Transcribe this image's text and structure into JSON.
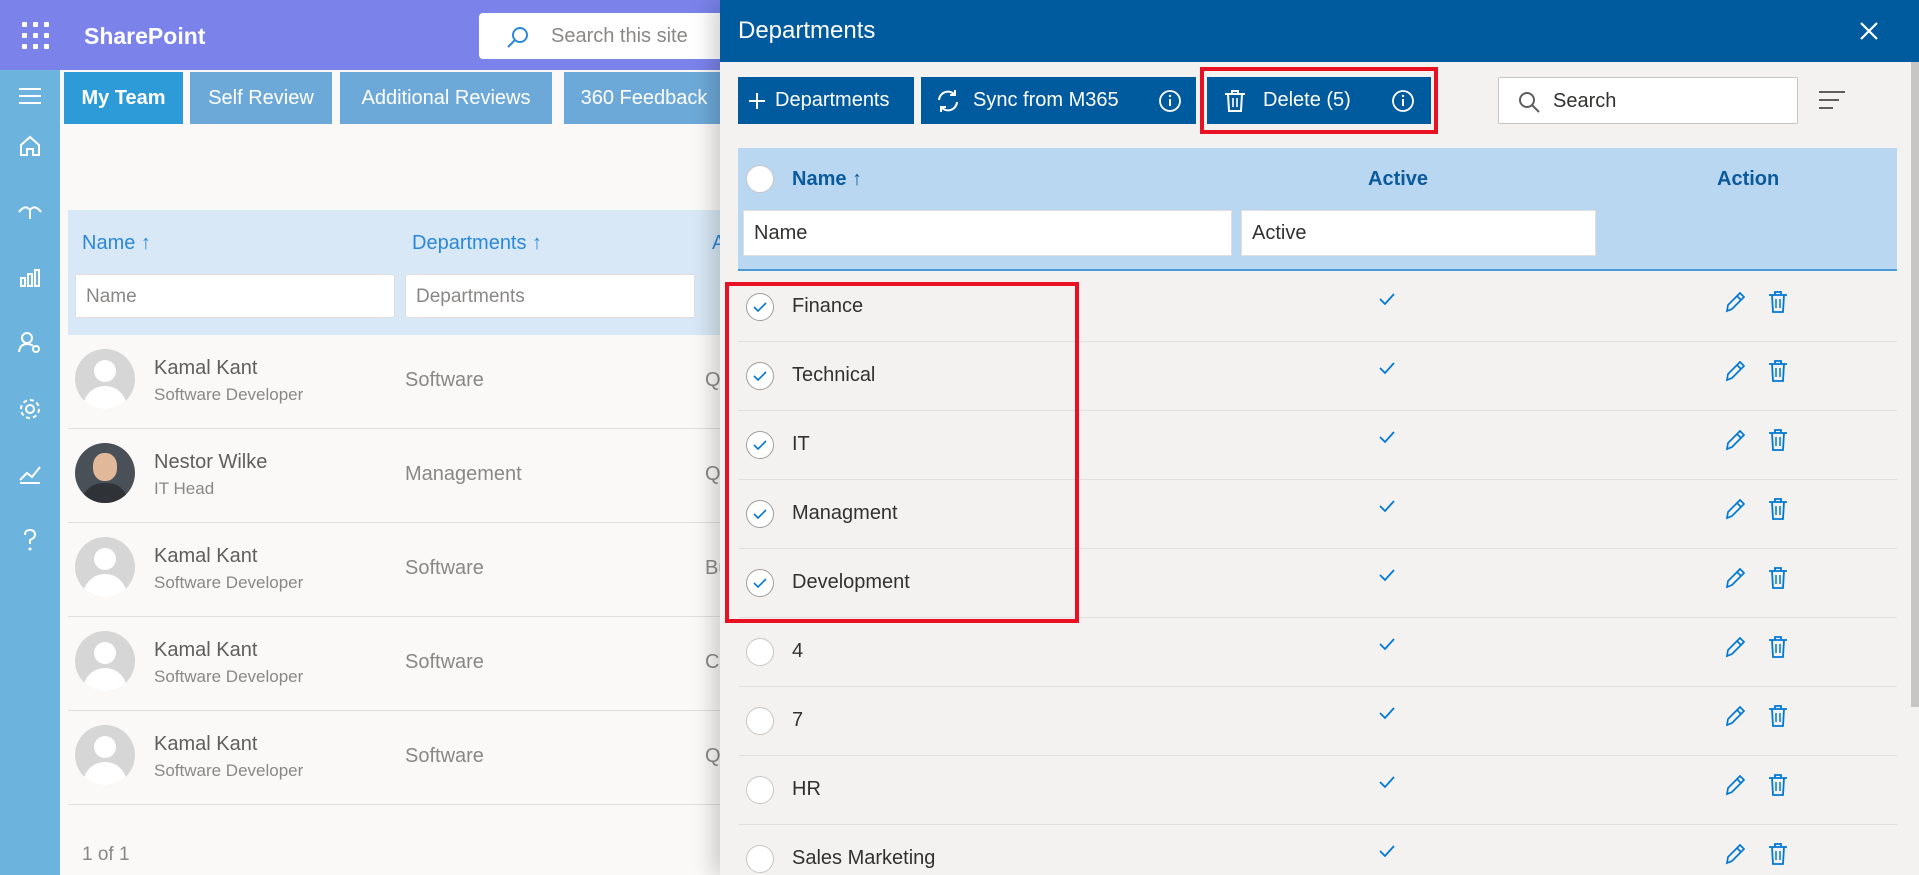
{
  "app": {
    "title": "SharePoint",
    "search_placeholder": "Search this site"
  },
  "rail": {
    "icons": [
      "hamburger-icon",
      "home-icon",
      "review-icon",
      "analytics-icon",
      "user-settings-icon",
      "settings-icon",
      "chart-icon",
      "help-icon"
    ]
  },
  "background": {
    "tabs": [
      "My Team",
      "Self Review",
      "Additional Reviews",
      "360 Feedback"
    ],
    "columns": {
      "name": "Name ↑",
      "departments": "Departments ↑",
      "third": "A"
    },
    "filters": {
      "name": "Name",
      "departments": "Departments"
    },
    "rows": [
      {
        "name": "Kamal Kant",
        "role": "Software Developer",
        "department": "Software",
        "extra": "Q",
        "avatar": "placeholder"
      },
      {
        "name": "Nestor Wilke",
        "role": "IT Head",
        "department": "Management",
        "extra": "Q",
        "avatar": "photo"
      },
      {
        "name": "Kamal Kant",
        "role": "Software Developer",
        "department": "Software",
        "extra": "Bu",
        "avatar": "placeholder"
      },
      {
        "name": "Kamal Kant",
        "role": "Software Developer",
        "department": "Software",
        "extra": "C",
        "avatar": "placeholder"
      },
      {
        "name": "Kamal Kant",
        "role": "Software Developer",
        "department": "Software",
        "extra": "Q",
        "avatar": "placeholder"
      }
    ],
    "pager": "1 of 1"
  },
  "panel": {
    "title": "Departments",
    "toolbar": {
      "add_label": "Departments",
      "sync_label": "Sync from M365",
      "delete_label": "Delete (5)",
      "search_placeholder": "Search"
    },
    "columns": {
      "name": "Name",
      "name_sort": "↑",
      "active": "Active",
      "action": "Action"
    },
    "filters": {
      "name": "Name",
      "active": "Active"
    },
    "rows": [
      {
        "name": "Finance",
        "selected": true,
        "active": true
      },
      {
        "name": "Technical",
        "selected": true,
        "active": true
      },
      {
        "name": "IT",
        "selected": true,
        "active": true
      },
      {
        "name": "Managment",
        "selected": true,
        "active": true
      },
      {
        "name": "Development",
        "selected": true,
        "active": true
      },
      {
        "name": "4",
        "selected": false,
        "active": true
      },
      {
        "name": "7",
        "selected": false,
        "active": true
      },
      {
        "name": "HR",
        "selected": false,
        "active": true
      },
      {
        "name": "Sales Marketing",
        "selected": false,
        "active": true
      }
    ]
  },
  "colors": {
    "topbar": "#7b83eb",
    "rail": "#6cb4de",
    "panel_header": "#005a9e",
    "highlight": "#e81123",
    "accent": "#0078d4"
  }
}
